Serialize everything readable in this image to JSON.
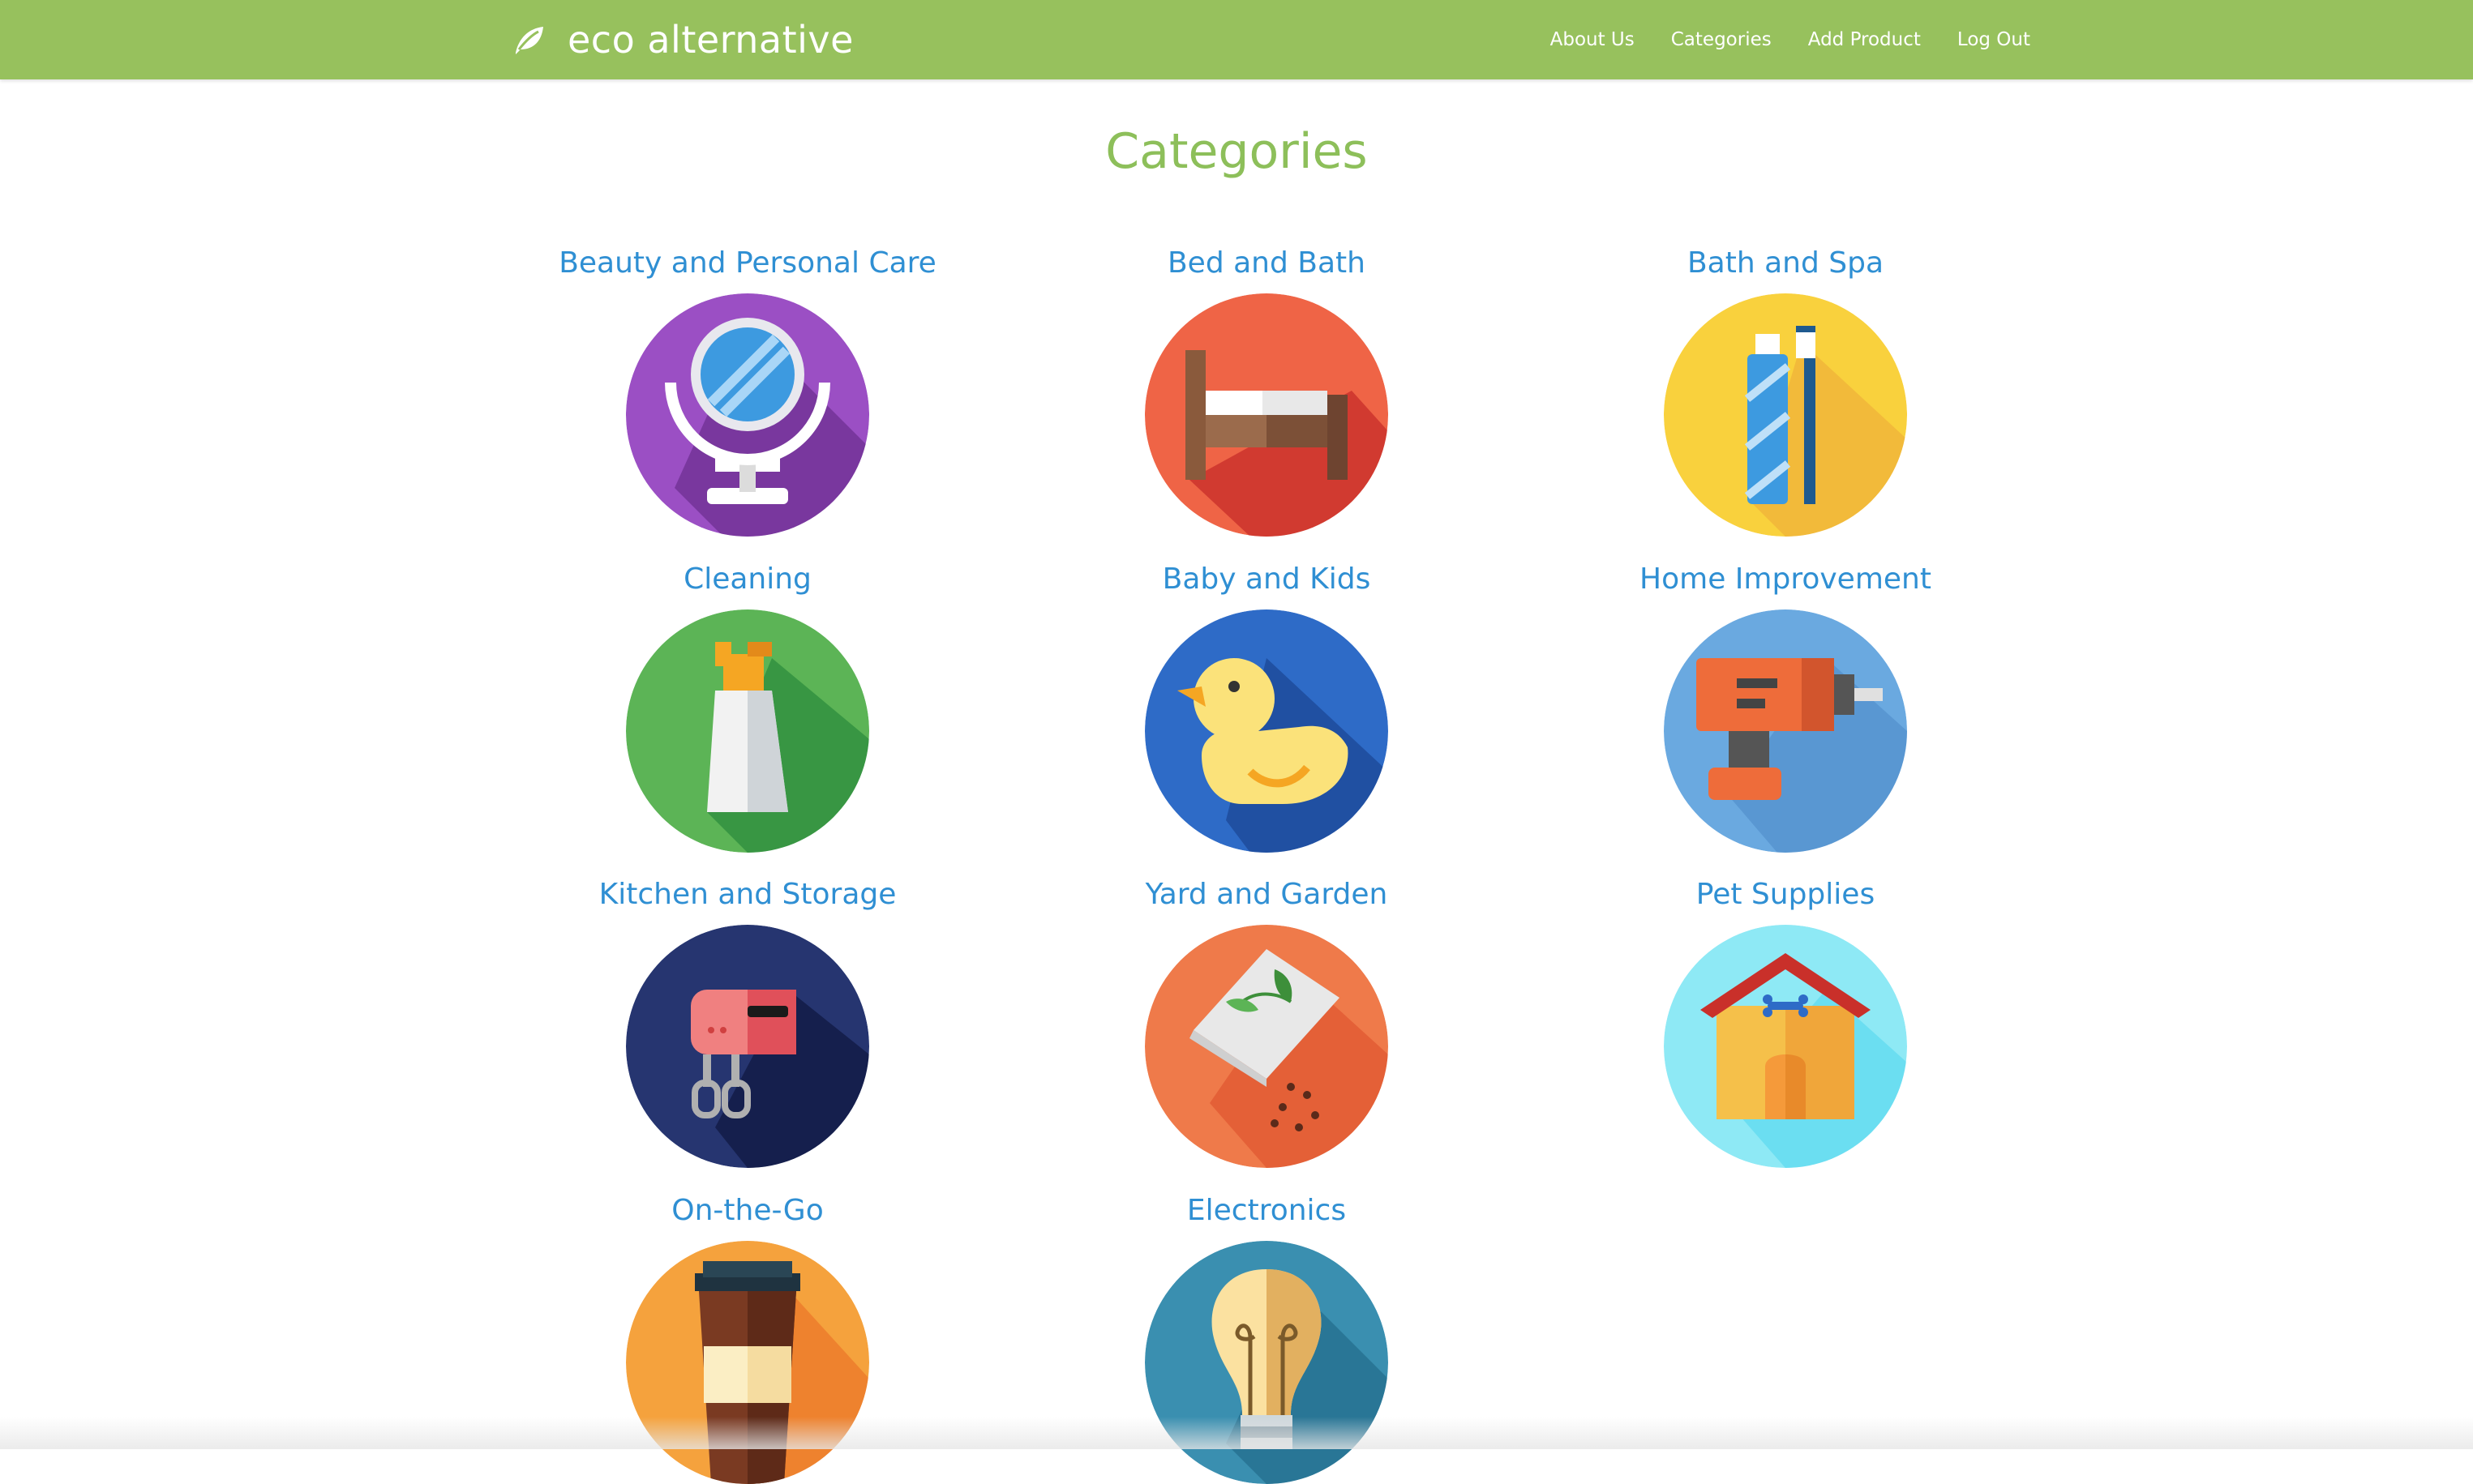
{
  "brand": {
    "name": "eco alternative",
    "icon": "leaf-icon"
  },
  "nav": [
    {
      "label": "About Us"
    },
    {
      "label": "Categories"
    },
    {
      "label": "Add Product"
    },
    {
      "label": "Log Out"
    }
  ],
  "page_title": "Categories",
  "categories": [
    {
      "label": "Beauty and Personal Care",
      "icon": "mirror-icon",
      "color": "#9b4fc4"
    },
    {
      "label": "Bed and Bath",
      "icon": "bed-icon",
      "color": "#ef6446"
    },
    {
      "label": "Bath and Spa",
      "icon": "toothpaste-icon",
      "color": "#f9d13d"
    },
    {
      "label": "Cleaning",
      "icon": "spray-bottle-icon",
      "color": "#5cb456"
    },
    {
      "label": "Baby and Kids",
      "icon": "rubber-duck-icon",
      "color": "#2e6bc7"
    },
    {
      "label": "Home Improvement",
      "icon": "drill-icon",
      "color": "#6aa9e0"
    },
    {
      "label": "Kitchen and Storage",
      "icon": "mixer-icon",
      "color": "#263570"
    },
    {
      "label": "Yard and Garden",
      "icon": "seed-packet-icon",
      "color": "#ef7a4a"
    },
    {
      "label": "Pet Supplies",
      "icon": "dog-house-icon",
      "color": "#8ee9f5"
    },
    {
      "label": "On-the-Go",
      "icon": "coffee-cup-icon",
      "color": "#f5a23d"
    },
    {
      "label": "Electronics",
      "icon": "light-bulb-icon",
      "color": "#3a8fb0"
    }
  ]
}
